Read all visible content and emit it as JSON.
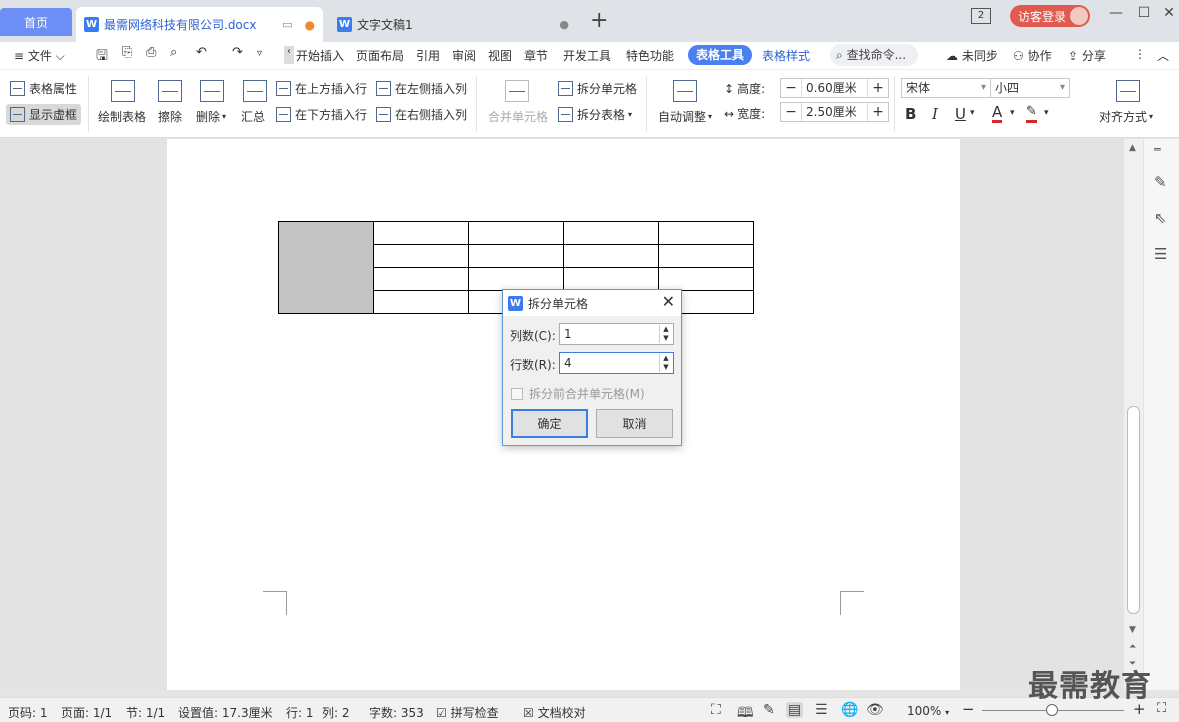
{
  "titlebar": {
    "home": "首页",
    "active_tab": "最需网络科技有限公司.docx",
    "inactive_tab": "文字文稿1",
    "add_tab": "+",
    "tab_icon": "W",
    "window_count": "2",
    "login": "访客登录",
    "minimize": "—",
    "maximize": "☐",
    "close": "✕"
  },
  "menubar": {
    "file": "≡ 文件 ⌵",
    "items": [
      "开始",
      "插入",
      "页面布局",
      "引用",
      "审阅",
      "视图",
      "章节",
      "开发工具",
      "特色功能"
    ],
    "table_tools": "表格工具",
    "table_style": "表格样式",
    "search": "查找命令...",
    "sync": "未同步",
    "collab": "协作",
    "share": "分享"
  },
  "ribbon": {
    "table_props": "表格属性",
    "show_grid": "显示虚框",
    "draw_table": "绘制表格",
    "erase": "擦除",
    "delete": "删除",
    "summary": "汇总",
    "insert_above": "在上方插入行",
    "insert_below": "在下方插入行",
    "insert_left": "在左侧插入列",
    "insert_right": "在右侧插入列",
    "merge_cells": "合并单元格",
    "split_cells": "拆分单元格",
    "split_table": "拆分表格",
    "auto_adjust": "自动调整",
    "height_label": "高度:",
    "height_value": "0.60厘米",
    "width_label": "宽度:",
    "width_value": "2.50厘米",
    "font_name": "宋体",
    "font_size": "小四",
    "bold": "B",
    "italic": "I",
    "underline": "U",
    "font_color": "A",
    "align": "对齐方式"
  },
  "dialog": {
    "title": "拆分单元格",
    "columns_label": "列数(C):",
    "columns_value": "1",
    "rows_label": "行数(R):",
    "rows_value": "4",
    "merge_before_split": "拆分前合并单元格(M)",
    "ok": "确定",
    "cancel": "取消"
  },
  "statusbar": {
    "page_num": "页码: 1",
    "pages": "页面: 1/1",
    "section": "节: 1/1",
    "setting": "设置值: 17.3厘米",
    "row": "行: 1",
    "col": "列: 2",
    "word_count": "字数: 353",
    "spell_check": "拼写检查",
    "doc_proof": "文档校对",
    "zoom": "100%"
  },
  "watermark": "最需教育",
  "colors": {
    "accent": "#4a7ff0",
    "home_tab": "#6c8ef5",
    "login": "#e05a4f",
    "merged_cell": "#c4c4c4"
  }
}
